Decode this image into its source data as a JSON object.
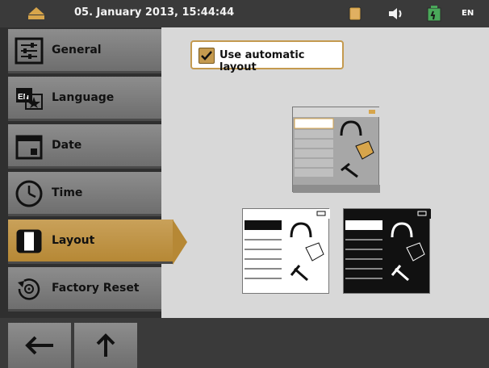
{
  "status_bar": {
    "datetime": "05. January 2013, 15:44:44",
    "language": "EN"
  },
  "sidebar": {
    "items": [
      {
        "label": "General",
        "icon": "sliders-icon"
      },
      {
        "label": "Language",
        "icon": "language-icon"
      },
      {
        "label": "Date",
        "icon": "calendar-icon"
      },
      {
        "label": "Time",
        "icon": "clock-icon"
      },
      {
        "label": "Layout",
        "icon": "layout-icon",
        "active": true
      },
      {
        "label": "Factory Reset",
        "icon": "factory-reset-icon"
      }
    ]
  },
  "main": {
    "auto_layout_label": "Use automatic layout",
    "auto_layout_checked": true
  },
  "colors": {
    "accent": "#c49a4f",
    "sidebar_gray": "#7e7e7e",
    "topbar": "#3a3a3a",
    "content_bg": "#d8d8d8"
  },
  "nav": {
    "back_icon": "arrow-left-icon",
    "up_icon": "arrow-up-icon"
  }
}
